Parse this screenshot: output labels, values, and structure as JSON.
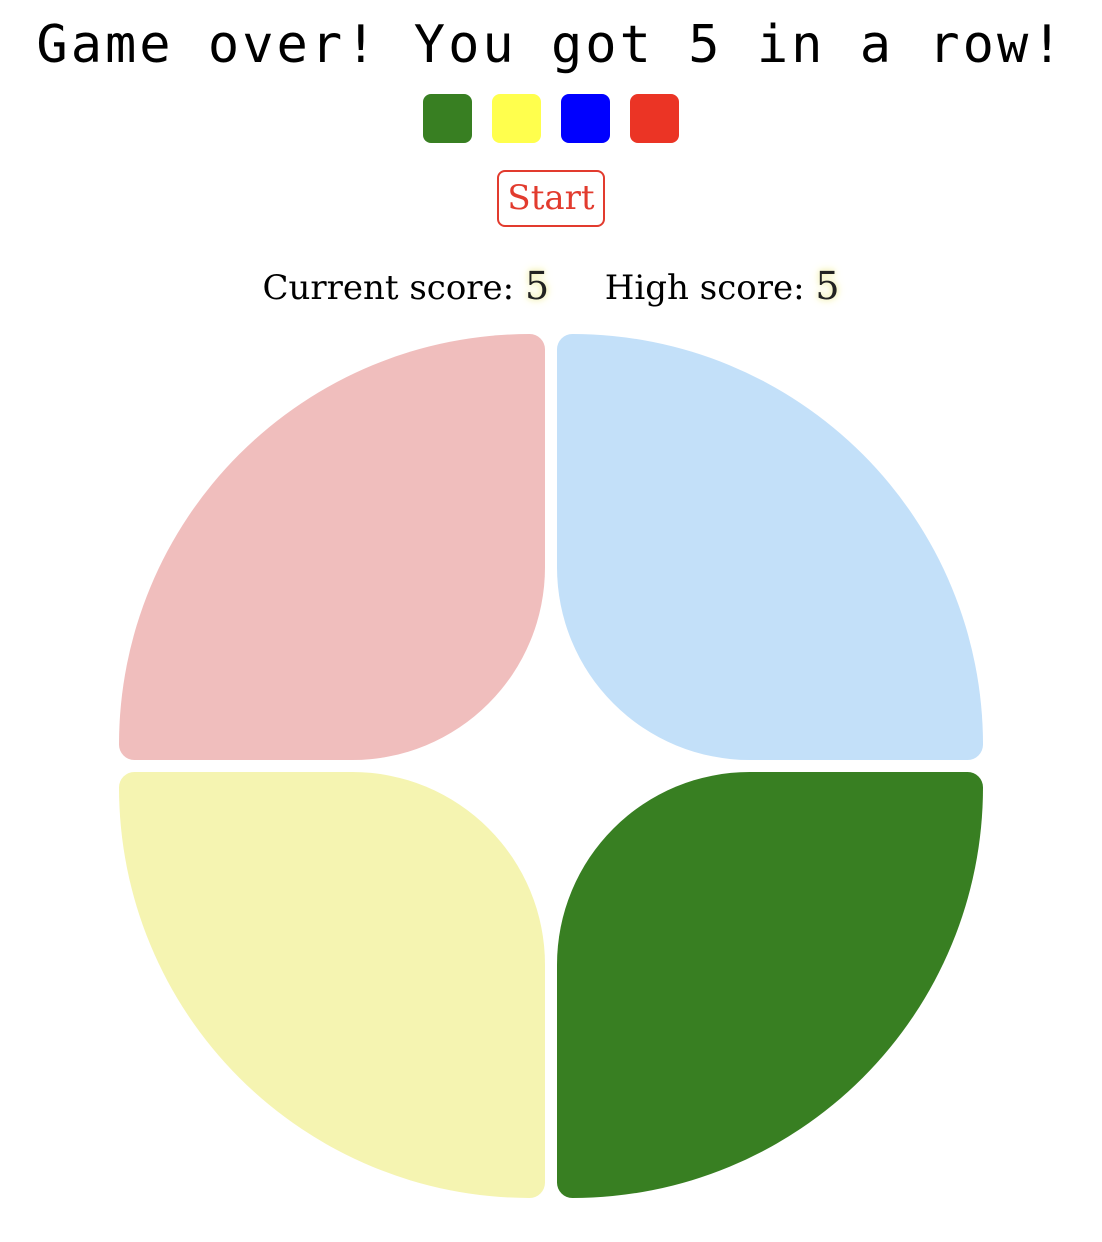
{
  "header": {
    "title": "Game over! You got 5 in a row!"
  },
  "sequence": [
    {
      "color_name": "green",
      "hex": "#387f22"
    },
    {
      "color_name": "yellow",
      "hex": "#ffff4d"
    },
    {
      "color_name": "blue",
      "hex": "#0000ff"
    },
    {
      "color_name": "red",
      "hex": "#eb3425"
    }
  ],
  "controls": {
    "start_label": "Start"
  },
  "scores": {
    "current_label": "Current score:",
    "current_value": "5",
    "high_label": "High score:",
    "high_value": "5"
  },
  "pads": {
    "top_left": {
      "color_name": "red",
      "hex": "#f0bebd",
      "lit": false
    },
    "top_right": {
      "color_name": "blue",
      "hex": "#c3e0f9",
      "lit": false
    },
    "bottom_left": {
      "color_name": "yellow",
      "hex": "#f5f4b1",
      "lit": false
    },
    "bottom_right": {
      "color_name": "green",
      "hex": "#387f22",
      "lit": true
    }
  }
}
